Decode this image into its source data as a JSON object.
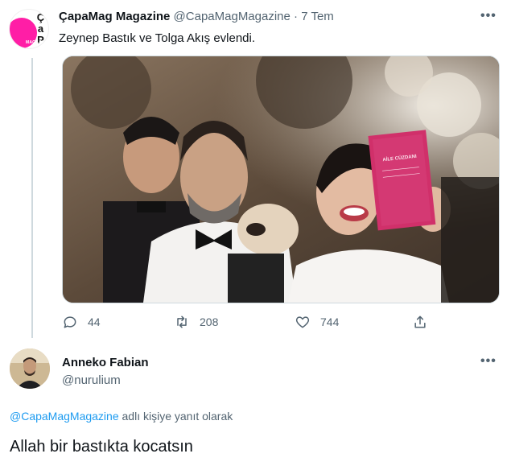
{
  "tweet": {
    "author_name": "ÇapaMag Magazine",
    "author_handle": "@CapaMagMagazine",
    "separator": "·",
    "time": "7 Tem",
    "text": "Zeynep Bastık ve Tolga Akış evlendi.",
    "avatar_text": "ÇaPA",
    "avatar_subtext": "MAGAZIN",
    "more": "•••",
    "media_booklet_title": "AİLE CÜZDANI",
    "replies": "44",
    "retweets": "208",
    "likes": "744"
  },
  "reply": {
    "author_name": "Anneko Fabian",
    "author_handle": "@nurulium",
    "more": "•••",
    "replying_to_mention": "@CapaMagMagazine",
    "replying_to_suffix": " adlı kişiye yanıt olarak",
    "text": "Allah bir bastıkta kocatsın"
  },
  "colors": {
    "brand_pink": "#ff1ea6",
    "link_blue": "#1d9bf0",
    "muted": "#536471",
    "booklet": "#d0306a"
  }
}
